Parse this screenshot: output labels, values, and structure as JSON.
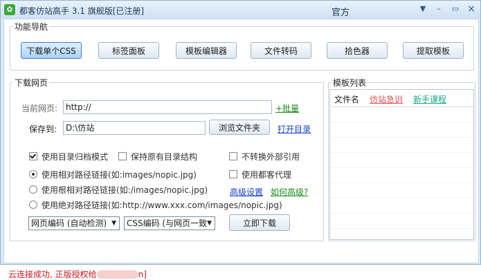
{
  "window": {
    "title": "都客仿站高手 3.1 旗舰版[已注册]",
    "logo_char": "✿",
    "official": "官方",
    "controls": {
      "menu": "▼",
      "minimize": "–",
      "restore": "▭",
      "close": "×"
    }
  },
  "nav": {
    "group_title": "功能导航",
    "buttons": [
      "下载单个CSS",
      "标签面板",
      "模板编辑器",
      "文件转码",
      "拾色器",
      "提取模板"
    ],
    "active_index": 0
  },
  "download": {
    "group_title": "下载网页",
    "current_page_label": "当前网页:",
    "current_page_value": "http://",
    "batch_link": "+批量",
    "save_to_label": "保存到:",
    "save_to_value": "D:\\仿站",
    "browse_button": "浏览文件夹",
    "open_dir_link": "打开目录",
    "options": {
      "archive_mode": {
        "label": "使用目录归档模式",
        "checked": true
      },
      "keep_structure": {
        "label": "保持原有目录结构",
        "checked": false
      },
      "no_convert_external": {
        "label": "不转换外部引用",
        "checked": false
      },
      "use_proxy": {
        "label": "使用都客代理",
        "checked": false
      }
    },
    "path_modes": [
      {
        "label": "使用相对路径链接(如:images/nopic.jpg)",
        "selected": true
      },
      {
        "label": "使用根相对路径链接(如:/images/nopic.jpg)",
        "selected": false
      },
      {
        "label": "使用绝对路径链接(如:http://www.xxx.com/images/nopic.jpg)",
        "selected": false
      }
    ],
    "advanced_link": "高级设置",
    "how_advanced_link": "如何高级?",
    "page_encoding": "网页编码 (自动检测)",
    "css_encoding": "CSS编码 (与网页一致",
    "download_button": "立即下载"
  },
  "templates": {
    "group_title": "模板列表",
    "header_filename": "文件名",
    "header_link_red": "仿站急训",
    "header_link_green": "新手课程"
  },
  "status": {
    "text": "云连接成功, 正版授权给",
    "suffix": "n]"
  },
  "colors": {
    "link_blue": "#1a3fc2",
    "link_green": "#1a8a1a",
    "link_red": "#d9534f",
    "link_teal": "#1aa58a",
    "status_red": "#d01818"
  }
}
